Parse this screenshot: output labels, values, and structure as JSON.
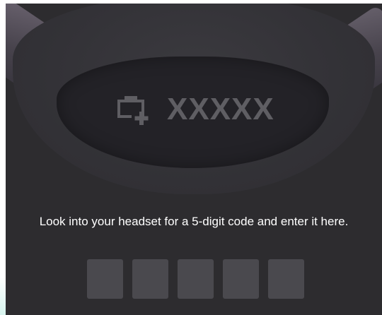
{
  "headset_graphic": {
    "code_placeholder": "XXXXX",
    "icon": "headset-pair-icon"
  },
  "instruction": "Look into your headset for a 5-digit code and enter it here.",
  "code_inputs": [
    {
      "value": ""
    },
    {
      "value": ""
    },
    {
      "value": ""
    },
    {
      "value": ""
    },
    {
      "value": ""
    }
  ],
  "colors": {
    "background": "#2d2c2f",
    "visor": "#232227",
    "code_text": "#5f5e63",
    "input_box": "#4a494e",
    "text": "#ffffff"
  }
}
